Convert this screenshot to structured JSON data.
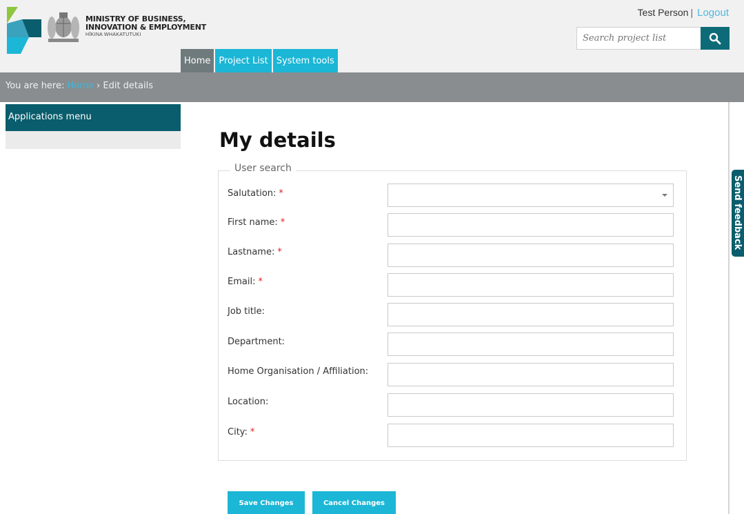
{
  "header": {
    "ministry_name_line1": "MINISTRY OF BUSINESS,",
    "ministry_name_line2": "INNOVATION & EMPLOYMENT",
    "ministry_subtitle": "HĪKINA WHAKATUTUKI",
    "user_name": "Test Person",
    "separator": "|",
    "logout_label": "Logout",
    "search_placeholder": "Search project list",
    "search_icon": "search-icon",
    "logo_colors": [
      "#8dc63f",
      "#1cb6d6",
      "#0a5d6c"
    ]
  },
  "nav": {
    "tabs": [
      {
        "label": "Home",
        "active": true
      },
      {
        "label": "Project List",
        "active": false
      },
      {
        "label": "System tools",
        "active": false
      }
    ]
  },
  "breadcrumb": {
    "prefix": "You are here: ",
    "home": "Home",
    "separator": " › ",
    "current": "Edit details"
  },
  "sidebar": {
    "title": "Applications menu"
  },
  "main": {
    "title": "My details",
    "legend": "User search",
    "fields": [
      {
        "label": "Salutation:",
        "required": true,
        "type": "select",
        "value": ""
      },
      {
        "label": "First name:",
        "required": true,
        "type": "text",
        "value": ""
      },
      {
        "label": "Lastname:",
        "required": true,
        "type": "text",
        "value": ""
      },
      {
        "label": "Email:",
        "required": true,
        "type": "text",
        "value": ""
      },
      {
        "label": "Job title:",
        "required": false,
        "type": "text",
        "value": ""
      },
      {
        "label": "Department:",
        "required": false,
        "type": "text",
        "value": ""
      },
      {
        "label": "Home Organisation / Affiliation:",
        "required": false,
        "type": "text",
        "value": ""
      },
      {
        "label": "Location:",
        "required": false,
        "type": "text",
        "value": ""
      },
      {
        "label": "City:",
        "required": true,
        "type": "text",
        "value": ""
      }
    ],
    "required_marker": "*",
    "save_label": "Save Changes",
    "cancel_label": "Cancel Changes"
  },
  "feedback": {
    "label": "Send feedback"
  },
  "colors": {
    "accent": "#1cb6d6",
    "dark_teal": "#0a5d6c",
    "breadcrumb_bar": "#8a8d8f",
    "active_tab": "#6f7a7d",
    "required": "#dd2222"
  }
}
